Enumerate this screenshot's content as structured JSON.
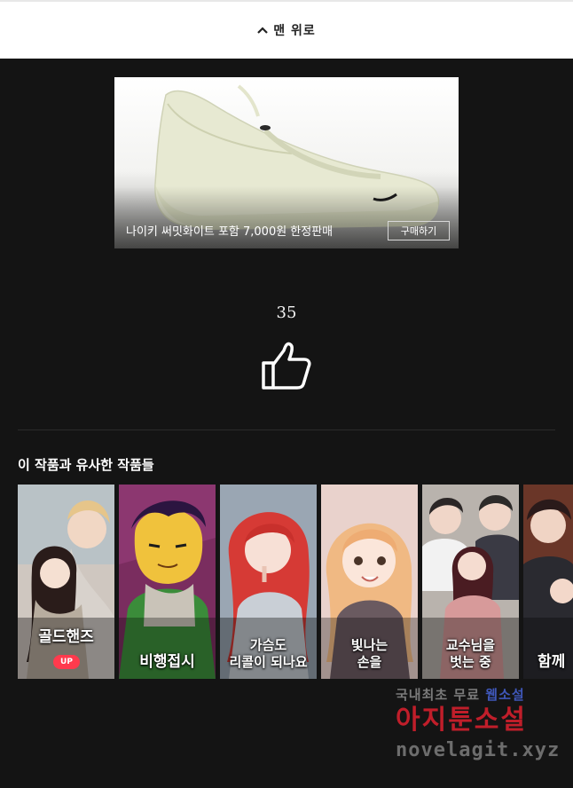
{
  "top_button": {
    "icon": "chevron-up-icon",
    "label": "맨 위로"
  },
  "ad": {
    "image": "sneaker-image",
    "caption": "나이키 써밋화이트 포함 7,000원 한정판매",
    "button": "구매하기"
  },
  "likes": {
    "count": "35",
    "icon": "thumbs-up-icon"
  },
  "similar": {
    "title": "이 작품과 유사한 작품들",
    "items": [
      {
        "title_line1": "골드핸즈",
        "title_line2": "",
        "badge": "UP"
      },
      {
        "title_line1": "비행접시",
        "title_line2": ""
      },
      {
        "title_line1": "가슴도",
        "title_line2": "리콜이 되나요"
      },
      {
        "title_line1": "빛나는",
        "title_line2": "손을"
      },
      {
        "title_line1": "교수님을",
        "title_line2": "벗는 중"
      },
      {
        "title_line1": "함께",
        "title_line2": ""
      }
    ]
  },
  "watermark": {
    "line1_a": "국내최초 무료",
    "line1_b": "웹소설",
    "line2": "아지툰소설",
    "line3": "novelagit.xyz"
  },
  "colors": {
    "background": "#141414",
    "badge": "#ff3a4d",
    "watermark_red": "#c01e2a"
  }
}
